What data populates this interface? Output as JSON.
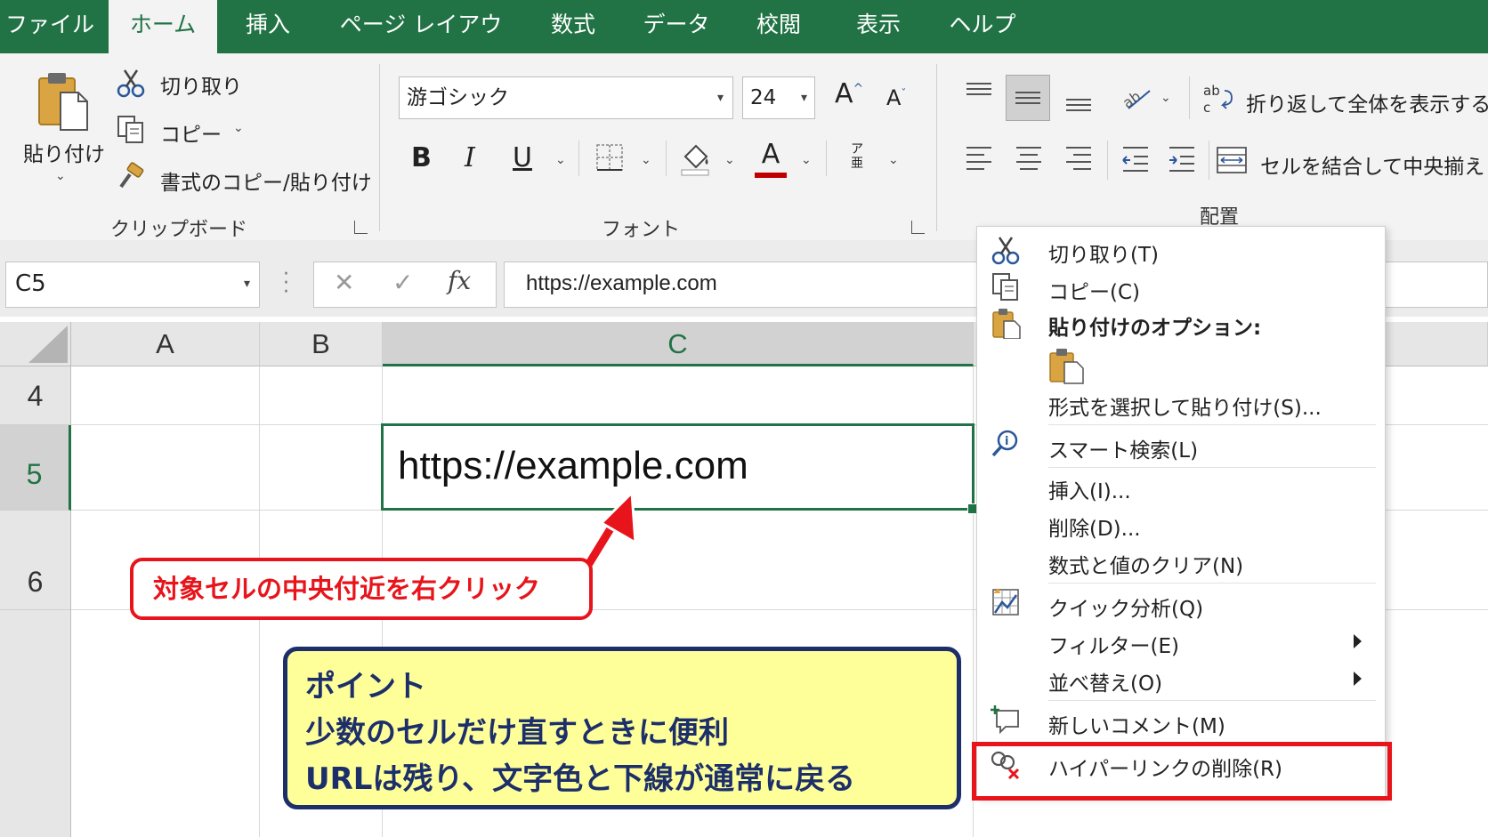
{
  "tabs": [
    {
      "label": "ファイル",
      "active": false
    },
    {
      "label": "ホーム",
      "active": true
    },
    {
      "label": "挿入",
      "active": false
    },
    {
      "label": "ページ レイアウト",
      "active": false
    },
    {
      "label": "数式",
      "active": false
    },
    {
      "label": "データ",
      "active": false
    },
    {
      "label": "校閲",
      "active": false
    },
    {
      "label": "表示",
      "active": false
    },
    {
      "label": "ヘルプ",
      "active": false
    }
  ],
  "ribbon": {
    "clipboard": {
      "paste": "貼り付け",
      "cut": "切り取り",
      "copy": "コピー",
      "format_painter": "書式のコピー/貼り付け",
      "group_label": "クリップボード"
    },
    "font": {
      "font_name": "游ゴシック",
      "font_size": "24",
      "bold": "B",
      "italic": "I",
      "underline": "U",
      "font_color_letter": "A",
      "grow_font": "A",
      "shrink_font": "A",
      "phonetic": "ア 亜",
      "group_label": "フォント"
    },
    "alignment": {
      "wrap_text": "折り返して全体を表示する",
      "merge_center": "セルを結合して中央揃え",
      "group_label": "配置"
    }
  },
  "formula_bar": {
    "name_box": "C5",
    "fx": "fx",
    "content": "https://example.com"
  },
  "grid": {
    "columns": [
      "A",
      "B",
      "C"
    ],
    "rows": [
      "4",
      "5",
      "6"
    ],
    "active_cell_value": "https://example.com"
  },
  "context_menu": {
    "cut": "切り取り(T)",
    "copy": "コピー(C)",
    "paste_options": "貼り付けのオプション:",
    "paste_special": "形式を選択して貼り付け(S)...",
    "smart_lookup": "スマート検索(L)",
    "insert": "挿入(I)...",
    "delete": "削除(D)...",
    "clear_contents": "数式と値のクリア(N)",
    "quick_analysis": "クイック分析(Q)",
    "filter": "フィルター(E)",
    "sort": "並べ替え(O)",
    "new_comment": "新しいコメント(M)",
    "remove_hyperlink": "ハイパーリンクの削除(R)"
  },
  "annotations": {
    "instruction": "対象セルの中央付近を右クリック",
    "point_title": "ポイント",
    "point_line1": "少数のセルだけ直すときに便利",
    "point_line2": "URLは残り、文字色と下線が通常に戻る"
  },
  "colors": {
    "excel_green": "#217346",
    "highlight_red": "#e8141b",
    "note_navy": "#1c2f6b",
    "note_yellow": "#ffff99"
  }
}
